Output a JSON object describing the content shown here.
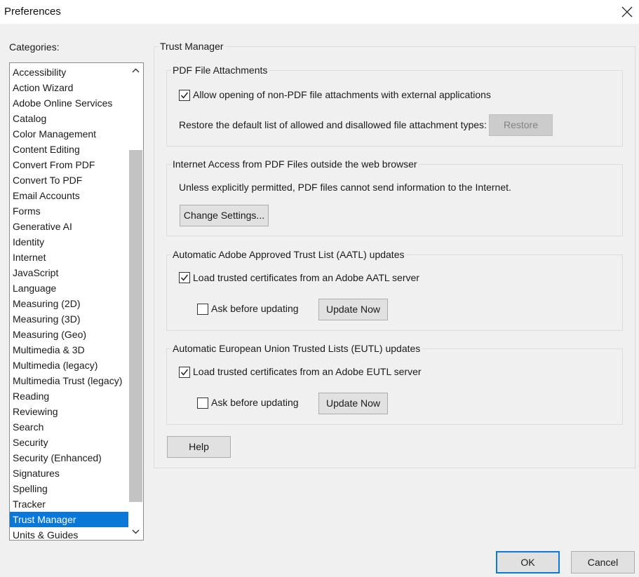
{
  "window": {
    "title": "Preferences"
  },
  "categories": {
    "label": "Categories:",
    "items": [
      "Accessibility",
      "Action Wizard",
      "Adobe Online Services",
      "Catalog",
      "Color Management",
      "Content Editing",
      "Convert From PDF",
      "Convert To PDF",
      "Email Accounts",
      "Forms",
      "Generative AI",
      "Identity",
      "Internet",
      "JavaScript",
      "Language",
      "Measuring (2D)",
      "Measuring (3D)",
      "Measuring (Geo)",
      "Multimedia & 3D",
      "Multimedia (legacy)",
      "Multimedia Trust (legacy)",
      "Reading",
      "Reviewing",
      "Search",
      "Security",
      "Security (Enhanced)",
      "Signatures",
      "Spelling",
      "Tracker",
      "Trust Manager",
      "Units & Guides"
    ],
    "selected": "Trust Manager"
  },
  "panel": {
    "title": "Trust Manager",
    "attachments": {
      "title": "PDF File Attachments",
      "allow_label": "Allow opening of non-PDF file attachments with external applications",
      "allow_checked": true,
      "restore_text": "Restore the default list of allowed and disallowed file attachment types:",
      "restore_button": "Restore"
    },
    "internet": {
      "title": "Internet Access from PDF Files outside the web browser",
      "info": "Unless explicitly permitted, PDF files cannot send information to the Internet.",
      "change_button": "Change Settings..."
    },
    "aatl": {
      "title": "Automatic Adobe Approved Trust List (AATL) updates",
      "load_label": "Load trusted certificates from an Adobe AATL server",
      "load_checked": true,
      "ask_label": "Ask before updating",
      "ask_checked": false,
      "update_button": "Update Now"
    },
    "eutl": {
      "title": "Automatic European Union Trusted Lists (EUTL) updates",
      "load_label": "Load trusted certificates from an Adobe EUTL server",
      "load_checked": true,
      "ask_label": "Ask before updating",
      "ask_checked": false,
      "update_button": "Update Now"
    },
    "help_button": "Help"
  },
  "footer": {
    "ok": "OK",
    "cancel": "Cancel"
  }
}
